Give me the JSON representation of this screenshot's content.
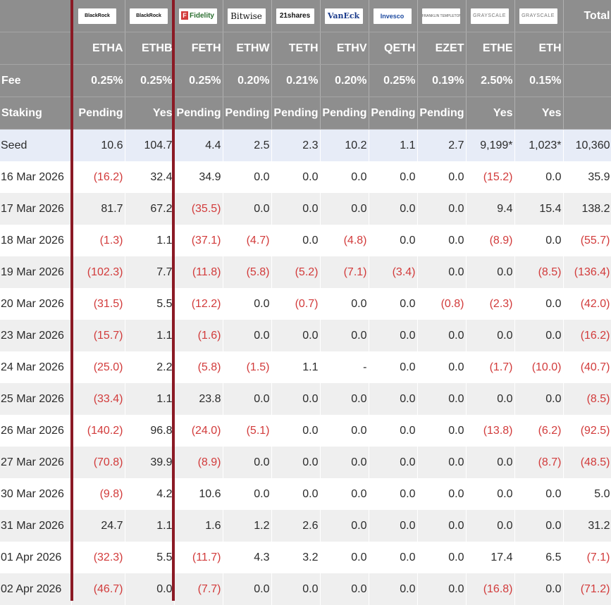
{
  "issuers": [
    {
      "name": "BlackRock",
      "style": "small"
    },
    {
      "name": "BlackRock",
      "style": "small"
    },
    {
      "name": "Fidelity",
      "style": "fid"
    },
    {
      "name": "Bitwise",
      "style": "bit"
    },
    {
      "name": "21shares",
      "style": "share"
    },
    {
      "name": "VanEck",
      "style": "vaneck"
    },
    {
      "name": "Invesco",
      "style": "inv"
    },
    {
      "name": "FRANKLIN TEMPLETON",
      "style": "ft"
    },
    {
      "name": "GRAYSCALE",
      "style": "gs"
    },
    {
      "name": "GRAYSCALE",
      "style": "gs"
    }
  ],
  "total_label": "Total",
  "tickers": [
    "ETHA",
    "ETHB",
    "FETH",
    "ETHW",
    "TETH",
    "ETHV",
    "QETH",
    "EZET",
    "ETHE",
    "ETH"
  ],
  "fee_label": "Fee",
  "fees": [
    "0.25%",
    "0.25%",
    "0.25%",
    "0.20%",
    "0.21%",
    "0.20%",
    "0.25%",
    "0.19%",
    "2.50%",
    "0.15%"
  ],
  "staking_label": "Staking",
  "staking": [
    "Pending",
    "Yes",
    "Pending",
    "Pending",
    "Pending",
    "Pending",
    "Pending",
    "Pending",
    "Yes",
    "Yes"
  ],
  "rows": [
    {
      "label": "Seed",
      "cells": [
        "10.6",
        "104.7",
        "4.4",
        "2.5",
        "2.3",
        "10.2",
        "1.1",
        "2.7",
        "9,199*",
        "1,023*",
        "10,360"
      ]
    },
    {
      "label": "16 Mar 2026",
      "cells": [
        "(16.2)",
        "32.4",
        "34.9",
        "0.0",
        "0.0",
        "0.0",
        "0.0",
        "0.0",
        "(15.2)",
        "0.0",
        "35.9"
      ]
    },
    {
      "label": "17 Mar 2026",
      "cells": [
        "81.7",
        "67.2",
        "(35.5)",
        "0.0",
        "0.0",
        "0.0",
        "0.0",
        "0.0",
        "9.4",
        "15.4",
        "138.2"
      ]
    },
    {
      "label": "18 Mar 2026",
      "cells": [
        "(1.3)",
        "1.1",
        "(37.1)",
        "(4.7)",
        "0.0",
        "(4.8)",
        "0.0",
        "0.0",
        "(8.9)",
        "0.0",
        "(55.7)"
      ]
    },
    {
      "label": "19 Mar 2026",
      "cells": [
        "(102.3)",
        "7.7",
        "(11.8)",
        "(5.8)",
        "(5.2)",
        "(7.1)",
        "(3.4)",
        "0.0",
        "0.0",
        "(8.5)",
        "(136.4)"
      ]
    },
    {
      "label": "20 Mar 2026",
      "cells": [
        "(31.5)",
        "5.5",
        "(12.2)",
        "0.0",
        "(0.7)",
        "0.0",
        "0.0",
        "(0.8)",
        "(2.3)",
        "0.0",
        "(42.0)"
      ]
    },
    {
      "label": "23 Mar 2026",
      "cells": [
        "(15.7)",
        "1.1",
        "(1.6)",
        "0.0",
        "0.0",
        "0.0",
        "0.0",
        "0.0",
        "0.0",
        "0.0",
        "(16.2)"
      ]
    },
    {
      "label": "24 Mar 2026",
      "cells": [
        "(25.0)",
        "2.2",
        "(5.8)",
        "(1.5)",
        "1.1",
        "-",
        "0.0",
        "0.0",
        "(1.7)",
        "(10.0)",
        "(40.7)"
      ]
    },
    {
      "label": "25 Mar 2026",
      "cells": [
        "(33.4)",
        "1.1",
        "23.8",
        "0.0",
        "0.0",
        "0.0",
        "0.0",
        "0.0",
        "0.0",
        "0.0",
        "(8.5)"
      ]
    },
    {
      "label": "26 Mar 2026",
      "cells": [
        "(140.2)",
        "96.8",
        "(24.0)",
        "(5.1)",
        "0.0",
        "0.0",
        "0.0",
        "0.0",
        "(13.8)",
        "(6.2)",
        "(92.5)"
      ]
    },
    {
      "label": "27 Mar 2026",
      "cells": [
        "(70.8)",
        "39.9",
        "(8.9)",
        "0.0",
        "0.0",
        "0.0",
        "0.0",
        "0.0",
        "0.0",
        "(8.7)",
        "(48.5)"
      ]
    },
    {
      "label": "30 Mar 2026",
      "cells": [
        "(9.8)",
        "4.2",
        "10.6",
        "0.0",
        "0.0",
        "0.0",
        "0.0",
        "0.0",
        "0.0",
        "0.0",
        "5.0"
      ]
    },
    {
      "label": "31 Mar 2026",
      "cells": [
        "24.7",
        "1.1",
        "1.6",
        "1.2",
        "2.6",
        "0.0",
        "0.0",
        "0.0",
        "0.0",
        "0.0",
        "31.2"
      ]
    },
    {
      "label": "01 Apr 2026",
      "cells": [
        "(32.3)",
        "5.5",
        "(11.7)",
        "4.3",
        "3.2",
        "0.0",
        "0.0",
        "0.0",
        "17.4",
        "6.5",
        "(7.1)"
      ]
    },
    {
      "label": "02 Apr 2026",
      "cells": [
        "(46.7)",
        "0.0",
        "(7.7)",
        "0.0",
        "0.0",
        "0.0",
        "0.0",
        "0.0",
        "(16.8)",
        "0.0",
        "(71.2)"
      ]
    }
  ]
}
